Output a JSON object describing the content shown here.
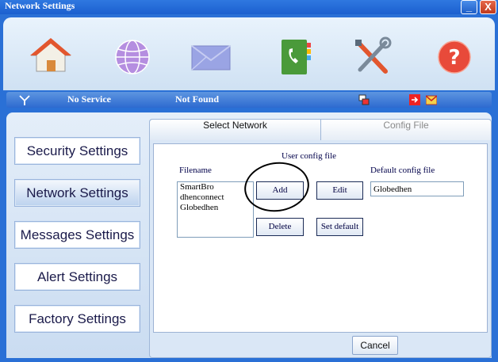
{
  "window": {
    "title": "Network Settings",
    "minimize": "_",
    "close": "X"
  },
  "toolbar": {
    "icons": [
      "home-icon",
      "internet-globe-icon",
      "messages-envelope-icon",
      "phonebook-icon",
      "settings-tools-icon",
      "help-icon"
    ]
  },
  "status": {
    "signal": "No Service",
    "network": "Not Found"
  },
  "sidebar": {
    "items": [
      {
        "label": "Security Settings"
      },
      {
        "label": "Network Settings"
      },
      {
        "label": "Messages Settings"
      },
      {
        "label": "Alert Settings"
      },
      {
        "label": "Factory Settings"
      }
    ]
  },
  "tabs": {
    "select": "Select Network",
    "config": "Config File"
  },
  "config": {
    "heading": "User config file",
    "filename_label": "Filename",
    "files": [
      "SmartBro",
      "dhenconnect",
      "Globedhen"
    ],
    "add": "Add",
    "edit": "Edit",
    "delete": "Delete",
    "set_default": "Set default",
    "default_label": "Default config file",
    "default_value": "Globedhen"
  },
  "footer": {
    "cancel": "Cancel"
  }
}
